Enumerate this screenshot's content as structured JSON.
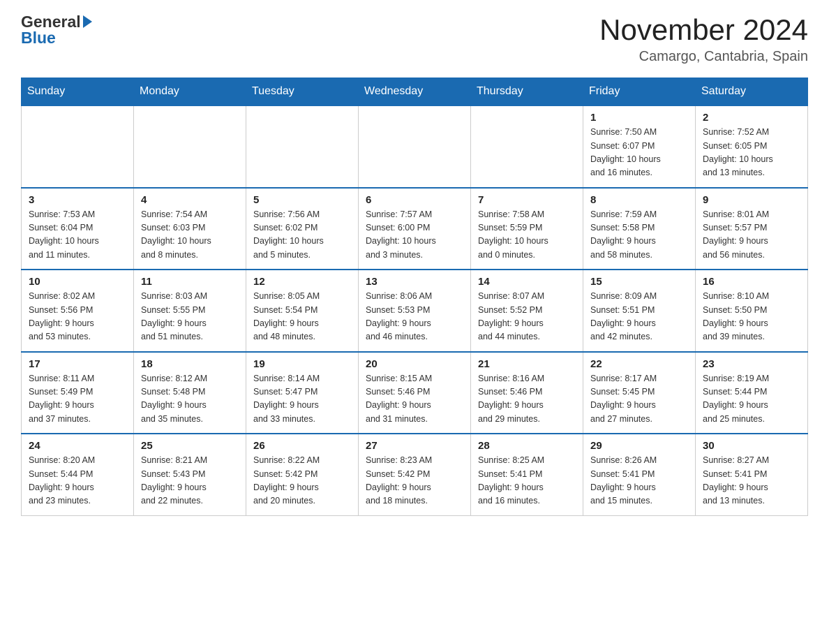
{
  "header": {
    "logo_line1": "General",
    "logo_line2": "Blue",
    "month_year": "November 2024",
    "location": "Camargo, Cantabria, Spain"
  },
  "days_of_week": [
    "Sunday",
    "Monday",
    "Tuesday",
    "Wednesday",
    "Thursday",
    "Friday",
    "Saturday"
  ],
  "weeks": [
    [
      {
        "day": "",
        "info": ""
      },
      {
        "day": "",
        "info": ""
      },
      {
        "day": "",
        "info": ""
      },
      {
        "day": "",
        "info": ""
      },
      {
        "day": "",
        "info": ""
      },
      {
        "day": "1",
        "info": "Sunrise: 7:50 AM\nSunset: 6:07 PM\nDaylight: 10 hours\nand 16 minutes."
      },
      {
        "day": "2",
        "info": "Sunrise: 7:52 AM\nSunset: 6:05 PM\nDaylight: 10 hours\nand 13 minutes."
      }
    ],
    [
      {
        "day": "3",
        "info": "Sunrise: 7:53 AM\nSunset: 6:04 PM\nDaylight: 10 hours\nand 11 minutes."
      },
      {
        "day": "4",
        "info": "Sunrise: 7:54 AM\nSunset: 6:03 PM\nDaylight: 10 hours\nand 8 minutes."
      },
      {
        "day": "5",
        "info": "Sunrise: 7:56 AM\nSunset: 6:02 PM\nDaylight: 10 hours\nand 5 minutes."
      },
      {
        "day": "6",
        "info": "Sunrise: 7:57 AM\nSunset: 6:00 PM\nDaylight: 10 hours\nand 3 minutes."
      },
      {
        "day": "7",
        "info": "Sunrise: 7:58 AM\nSunset: 5:59 PM\nDaylight: 10 hours\nand 0 minutes."
      },
      {
        "day": "8",
        "info": "Sunrise: 7:59 AM\nSunset: 5:58 PM\nDaylight: 9 hours\nand 58 minutes."
      },
      {
        "day": "9",
        "info": "Sunrise: 8:01 AM\nSunset: 5:57 PM\nDaylight: 9 hours\nand 56 minutes."
      }
    ],
    [
      {
        "day": "10",
        "info": "Sunrise: 8:02 AM\nSunset: 5:56 PM\nDaylight: 9 hours\nand 53 minutes."
      },
      {
        "day": "11",
        "info": "Sunrise: 8:03 AM\nSunset: 5:55 PM\nDaylight: 9 hours\nand 51 minutes."
      },
      {
        "day": "12",
        "info": "Sunrise: 8:05 AM\nSunset: 5:54 PM\nDaylight: 9 hours\nand 48 minutes."
      },
      {
        "day": "13",
        "info": "Sunrise: 8:06 AM\nSunset: 5:53 PM\nDaylight: 9 hours\nand 46 minutes."
      },
      {
        "day": "14",
        "info": "Sunrise: 8:07 AM\nSunset: 5:52 PM\nDaylight: 9 hours\nand 44 minutes."
      },
      {
        "day": "15",
        "info": "Sunrise: 8:09 AM\nSunset: 5:51 PM\nDaylight: 9 hours\nand 42 minutes."
      },
      {
        "day": "16",
        "info": "Sunrise: 8:10 AM\nSunset: 5:50 PM\nDaylight: 9 hours\nand 39 minutes."
      }
    ],
    [
      {
        "day": "17",
        "info": "Sunrise: 8:11 AM\nSunset: 5:49 PM\nDaylight: 9 hours\nand 37 minutes."
      },
      {
        "day": "18",
        "info": "Sunrise: 8:12 AM\nSunset: 5:48 PM\nDaylight: 9 hours\nand 35 minutes."
      },
      {
        "day": "19",
        "info": "Sunrise: 8:14 AM\nSunset: 5:47 PM\nDaylight: 9 hours\nand 33 minutes."
      },
      {
        "day": "20",
        "info": "Sunrise: 8:15 AM\nSunset: 5:46 PM\nDaylight: 9 hours\nand 31 minutes."
      },
      {
        "day": "21",
        "info": "Sunrise: 8:16 AM\nSunset: 5:46 PM\nDaylight: 9 hours\nand 29 minutes."
      },
      {
        "day": "22",
        "info": "Sunrise: 8:17 AM\nSunset: 5:45 PM\nDaylight: 9 hours\nand 27 minutes."
      },
      {
        "day": "23",
        "info": "Sunrise: 8:19 AM\nSunset: 5:44 PM\nDaylight: 9 hours\nand 25 minutes."
      }
    ],
    [
      {
        "day": "24",
        "info": "Sunrise: 8:20 AM\nSunset: 5:44 PM\nDaylight: 9 hours\nand 23 minutes."
      },
      {
        "day": "25",
        "info": "Sunrise: 8:21 AM\nSunset: 5:43 PM\nDaylight: 9 hours\nand 22 minutes."
      },
      {
        "day": "26",
        "info": "Sunrise: 8:22 AM\nSunset: 5:42 PM\nDaylight: 9 hours\nand 20 minutes."
      },
      {
        "day": "27",
        "info": "Sunrise: 8:23 AM\nSunset: 5:42 PM\nDaylight: 9 hours\nand 18 minutes."
      },
      {
        "day": "28",
        "info": "Sunrise: 8:25 AM\nSunset: 5:41 PM\nDaylight: 9 hours\nand 16 minutes."
      },
      {
        "day": "29",
        "info": "Sunrise: 8:26 AM\nSunset: 5:41 PM\nDaylight: 9 hours\nand 15 minutes."
      },
      {
        "day": "30",
        "info": "Sunrise: 8:27 AM\nSunset: 5:41 PM\nDaylight: 9 hours\nand 13 minutes."
      }
    ]
  ]
}
